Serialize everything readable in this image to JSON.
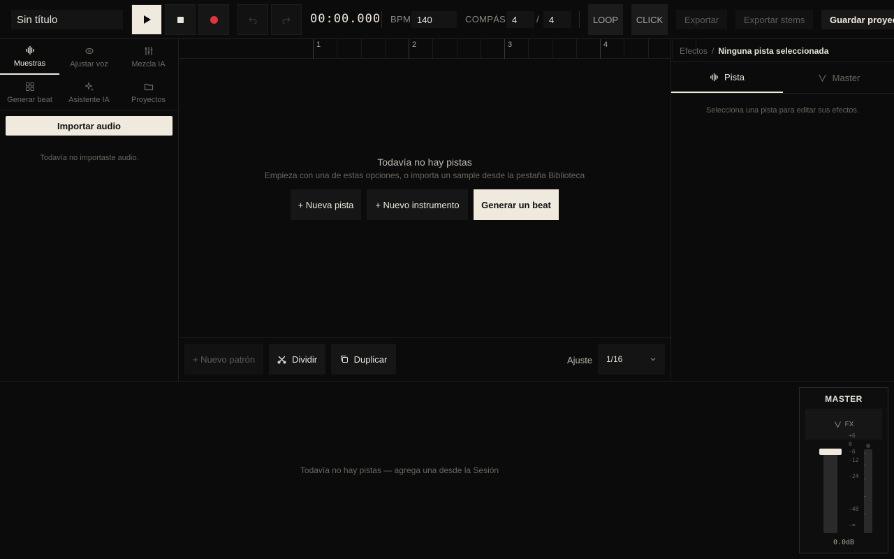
{
  "topbar": {
    "project_title": "Sin título",
    "timecode": "00:00.000",
    "bpm_label": "BPM",
    "bpm_value": "140",
    "meter_label": "COMPÁS",
    "meter_num": "4",
    "meter_sep": "/",
    "meter_den": "4",
    "loop_label": "LOOP",
    "click_label": "CLICK",
    "export_label": "Exportar",
    "export_stems_label": "Exportar stems",
    "save_label": "Guardar proyecto"
  },
  "left_panel": {
    "tabs": [
      {
        "label": "Muestras",
        "icon": "waveform-icon",
        "active": true
      },
      {
        "label": "Ajustar voz",
        "icon": "voice-icon",
        "active": false
      },
      {
        "label": "Mezcla IA",
        "icon": "sliders-icon",
        "active": false
      },
      {
        "label": "Generar beat",
        "icon": "grid-icon",
        "active": false
      },
      {
        "label": "Asistente IA",
        "icon": "sparkle-icon",
        "active": false
      },
      {
        "label": "Proyectos",
        "icon": "folder-icon",
        "active": false
      }
    ],
    "import_button": "Importar audio",
    "empty_text": "Todavía no importaste audio."
  },
  "timeline": {
    "bars": [
      "1",
      "2",
      "3",
      "4"
    ],
    "empty_title": "Todavía no hay pistas",
    "empty_subtitle": "Empieza con una de estas opciones, o importa un sample desde la pestaña Biblioteca",
    "new_track": "+ Nueva pista",
    "new_instrument": "+ Nuevo instrumento",
    "generate_beat": "Generar un beat"
  },
  "toolbar": {
    "new_pattern": "+ Nuevo patrón",
    "split": "Dividir",
    "duplicate": "Duplicar",
    "snap_label": "Ajuste",
    "snap_value": "1/16"
  },
  "effects_panel": {
    "crumb_root": "Efectos",
    "crumb_sep": "/",
    "crumb_current": "Ninguna pista seleccionada",
    "tab_track": "Pista",
    "tab_master": "Master",
    "hint": "Selecciona una pista para editar sus efectos."
  },
  "mixer": {
    "empty_text": "Todavía no hay pistas — agrega una desde la Sesión",
    "master_title": "MASTER",
    "fx_label": "FX",
    "scale": [
      "+6",
      "0",
      "-6",
      "-12",
      "-24",
      "-48",
      "-∞"
    ],
    "db_readout": "0.0dB",
    "fader_level_db": 0.0
  },
  "colors": {
    "background": "#0b0b0b",
    "accent": "#efe9de",
    "record": "#e5333d"
  }
}
